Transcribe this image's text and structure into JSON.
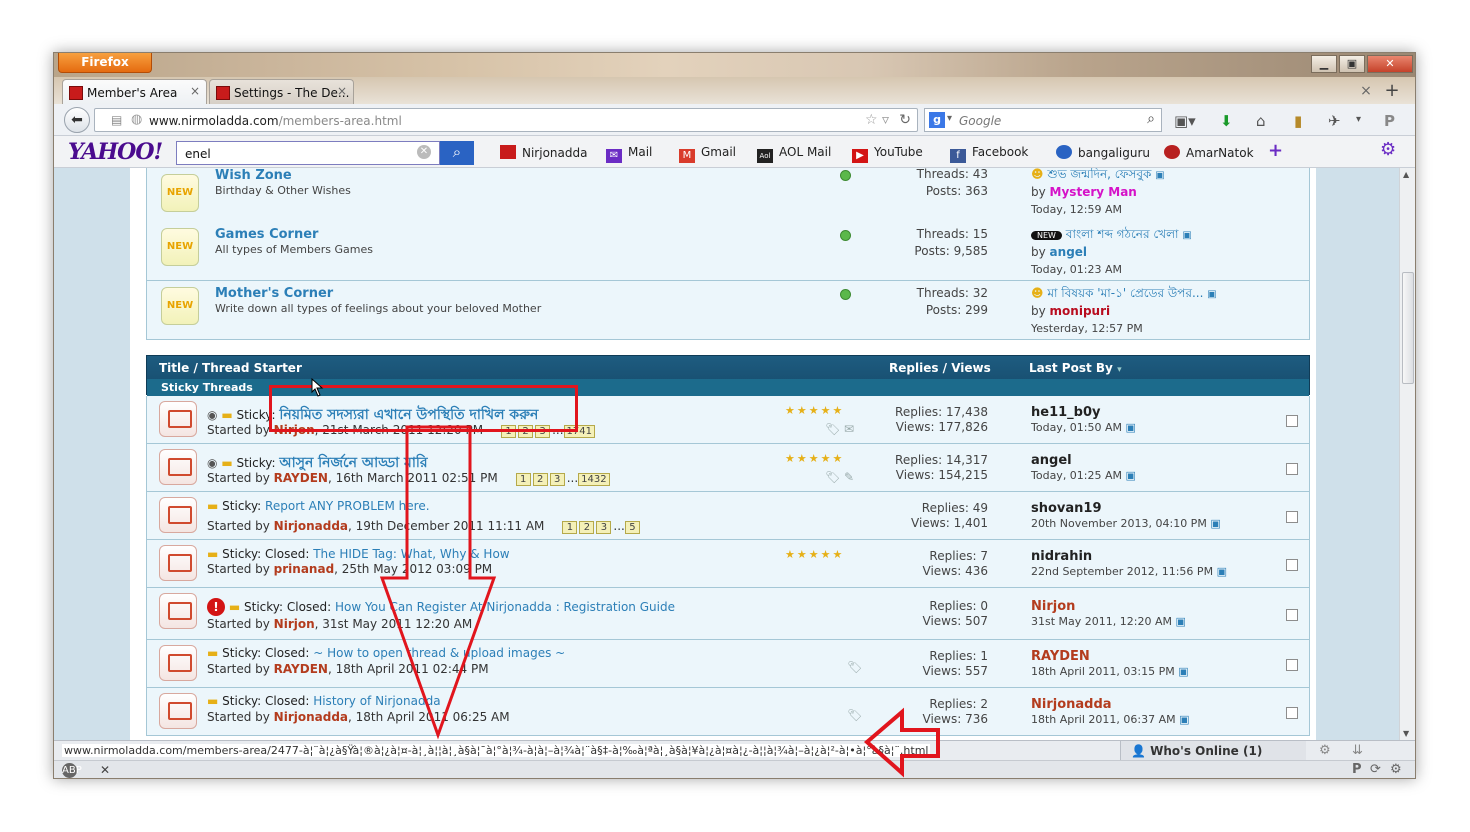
{
  "browser": {
    "app_button": "Firefox",
    "tabs": [
      {
        "label": "Member's Area",
        "close": "×"
      },
      {
        "label": "Settings - The De...",
        "close": "×"
      }
    ],
    "tab_new": "+",
    "tab_list": "×",
    "url_host": "www.nirmoladda.com",
    "url_path": "/members-area.html",
    "search_placeholder": "Google"
  },
  "yahoo": {
    "logo": "YAHOO!",
    "query": "enel",
    "links": [
      "Nirjonadda",
      "Mail",
      "Gmail",
      "AOL Mail",
      "YouTube",
      "Facebook",
      "bangaliguru",
      "AmarNatok"
    ],
    "add": "+"
  },
  "forums": [
    {
      "badge": "NEW",
      "title": "Wish Zone",
      "desc": "Birthday & Other Wishes",
      "threads": "Threads: 43",
      "posts": "Posts: 363",
      "last_title": "শুভ জন্মদিন, ফেসবুক",
      "by": "by",
      "user": "Mystery Man",
      "user_color": "#d512c8",
      "time": "Today, 12:59 AM"
    },
    {
      "badge": "NEW",
      "title": "Games Corner",
      "desc": "All types of Members Games",
      "threads": "Threads: 15",
      "posts": "Posts: 9,585",
      "last_title": "বাংলা শব্দ গঠনের খেলা",
      "by": "by",
      "user": "angel",
      "user_color": "#2c7fb7",
      "time": "Today, 01:23 AM",
      "prefix": "NEW"
    },
    {
      "badge": "NEW",
      "title": "Mother's Corner",
      "desc": "Write down all types of feelings about your beloved Mother",
      "threads": "Threads: 32",
      "posts": "Posts: 299",
      "last_title": "মা বিষয়ক 'মা-১' প্রেডের উপর...",
      "by": "by",
      "user": "monipuri",
      "user_color": "#b80c1e",
      "time": "Yesterday, 12:57 PM"
    }
  ],
  "thread_header": {
    "title": "Title / Thread Starter",
    "replies": "Replies / Views",
    "last": "Last Post By",
    "sticky": "Sticky Threads"
  },
  "threads": [
    {
      "prefix": "Sticky: ",
      "title": "নিয়মিত সদস্যরা এখানে উপস্থিতি দাখিল করুন",
      "started_label": "Started by ",
      "user": "Nirjon",
      "date": ", 21st March 2011 12:20 PM",
      "pages": [
        "1",
        "2",
        "3",
        "...",
        "1741"
      ],
      "stars": "★★★★★",
      "replies": "Replies: 17,438",
      "views": "Views: 177,826",
      "last_user": "he11_b0y",
      "last_date": "Today, 01:50 AM"
    },
    {
      "prefix": "Sticky: ",
      "title": "আসুন নির্জনে আড্ডা মারি",
      "started_label": "Started by ",
      "user": "RAYDEN",
      "date": ", 16th March 2011 02:51 PM",
      "pages": [
        "1",
        "2",
        "3",
        "...",
        "1432"
      ],
      "stars": "★★★★★",
      "replies": "Replies: 14,317",
      "views": "Views: 154,215",
      "last_user": "angel",
      "last_date": "Today, 01:25 AM"
    },
    {
      "prefix": "Sticky: ",
      "title": "Report ANY PROBLEM here.",
      "started_label": "Started by ",
      "user": "Nirjonadda",
      "date": ", 19th December 2011 11:11 AM",
      "pages": [
        "1",
        "2",
        "3",
        "...",
        "5"
      ],
      "stars": "",
      "replies": "Replies: 49",
      "views": "Views: 1,401",
      "last_user": "shovan19",
      "last_date": "20th November 2013, 04:10 PM"
    },
    {
      "prefix": "Sticky: Closed: ",
      "title": "The HIDE Tag: What, Why & How",
      "started_label": "Started by ",
      "user": "prinanad",
      "date": ", 25th May 2012 03:09 PM",
      "pages": [],
      "stars": "★★★★★",
      "replies": "Replies: 7",
      "views": "Views: 436",
      "last_user": "nidrahin",
      "last_date": "22nd September 2012, 11:56 PM"
    },
    {
      "prefix": "Sticky: Closed: ",
      "title": "How You Can Register At Nirjonadda : Registration Guide",
      "started_label": "Started by ",
      "user": "Nirjon",
      "date": ", 31st May 2011 12:20 AM",
      "pages": [],
      "stars": "",
      "replies": "Replies: 0",
      "views": "Views: 507",
      "last_user": "Nirjon",
      "last_date": "31st May 2011, 12:20 AM"
    },
    {
      "prefix": "Sticky: Closed: ",
      "title": "~ How to open thread & upload images ~",
      "started_label": "Started by ",
      "user": "RAYDEN",
      "date": ", 18th April 2011 02:44 PM",
      "pages": [],
      "stars": "",
      "replies": "Replies: 1",
      "views": "Views: 557",
      "last_user": "RAYDEN",
      "last_date": "18th April 2011, 03:15 PM"
    },
    {
      "prefix": "Sticky: Closed: ",
      "title": "History of Nirjonadda",
      "started_label": "Started by ",
      "user": "Nirjonadda",
      "date": ", 18th April 2011 06:25 AM",
      "pages": [],
      "stars": "",
      "replies": "Replies: 2",
      "views": "Views: 736",
      "last_user": "Nirjonadda",
      "last_date": "18th April 2011, 06:37 AM"
    }
  ],
  "status": {
    "url": "www.nirmoladda.com/members-area/2477-à¦¨à¦¿à§Ÿà¦®à¦¿à¦¤-à¦¸à¦¦à¦¸à§à¦¯à¦°à¦¾-à¦à¦–à¦¾à¦¨à§‡-à¦‰à¦ªà¦¸à§à¦¥à¦¿à¦¤à¦¿-à¦¦à¦¾à¦–à¦¿à¦²-à¦•à¦°à§à¦¨.html",
    "who_online": "Who's Online (1)"
  },
  "colors": {
    "annotation": "#e1151d",
    "link": "#2c7fb7",
    "header": "#1e5c80"
  }
}
